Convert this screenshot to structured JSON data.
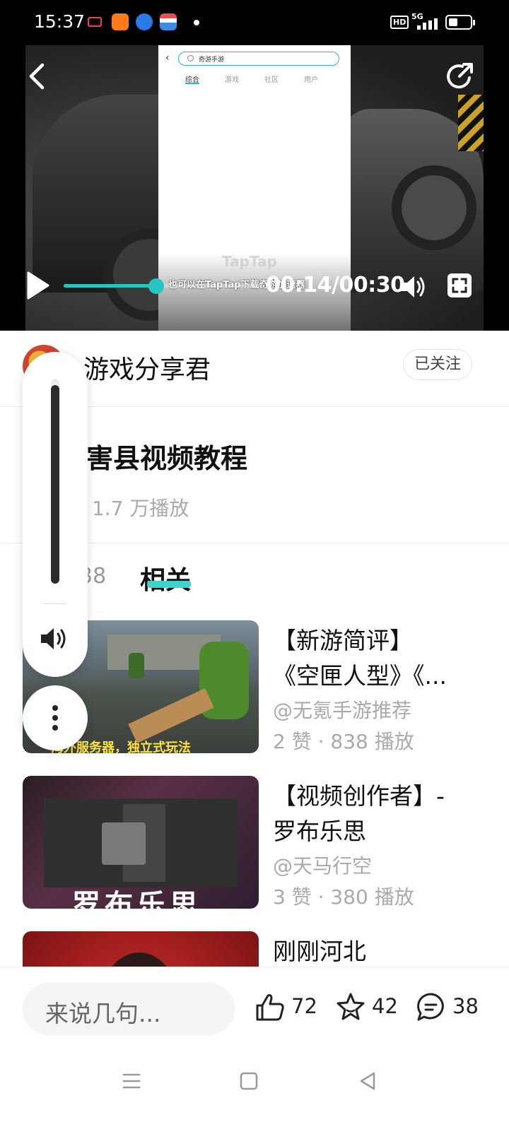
{
  "status_bar": {
    "time": "15:37",
    "hd": "HD",
    "network": "5G"
  },
  "player": {
    "in_video": {
      "search_text": "奇游手游",
      "tabs": [
        "综合",
        "游戏",
        "社区",
        "用户"
      ],
      "watermark": "TapTap",
      "subtitle": "也可以在TapTap下载奇游加速器"
    },
    "timecode": "00:14/00:30",
    "progress_fraction": 0.4667,
    "icons": {
      "back": "back-arrow-icon",
      "share": "share-icon",
      "play": "play-icon",
      "volume": "volume-icon",
      "fullscreen": "fullscreen-icon"
    }
  },
  "author": {
    "name": "游戏分享君",
    "follow_label": "已关注"
  },
  "video_info": {
    "title": "害县视频教程",
    "plays": "1.7 万播放"
  },
  "tabs": {
    "comments_count": "38",
    "related_label": "相关"
  },
  "related": [
    {
      "title_line1": "【新游简评】",
      "title_line2": "《空匣人型》《...",
      "author": "@无氪手游推荐",
      "stats": "2 赞 · 838 播放",
      "thumb_caption": "海外服务器，独立式玩法"
    },
    {
      "title_line1": "【视频创作者】-",
      "title_line2": "罗布乐思",
      "author": "@天马行空",
      "stats": "3 赞 · 380 播放",
      "thumb_caption": "罗布乐思"
    },
    {
      "title_line1": "刚刚河北",
      "title_line2": "",
      "author": "",
      "stats": "",
      "thumb_caption": ""
    }
  ],
  "volume_overlay": {
    "level_fraction": 0.97,
    "icon": "volume-icon",
    "more_icon": "more-vertical-icon"
  },
  "bottom_bar": {
    "comment_placeholder": "来说几句...",
    "likes": "72",
    "favorites": "42",
    "comments": "38"
  },
  "nav_bar": {
    "icons": [
      "menu-icon",
      "home-square-icon",
      "back-triangle-icon"
    ]
  },
  "colors": {
    "accent": "#27c4c4",
    "tab_underline": "#3fd3cc",
    "muted_text": "#aaaaaa"
  }
}
